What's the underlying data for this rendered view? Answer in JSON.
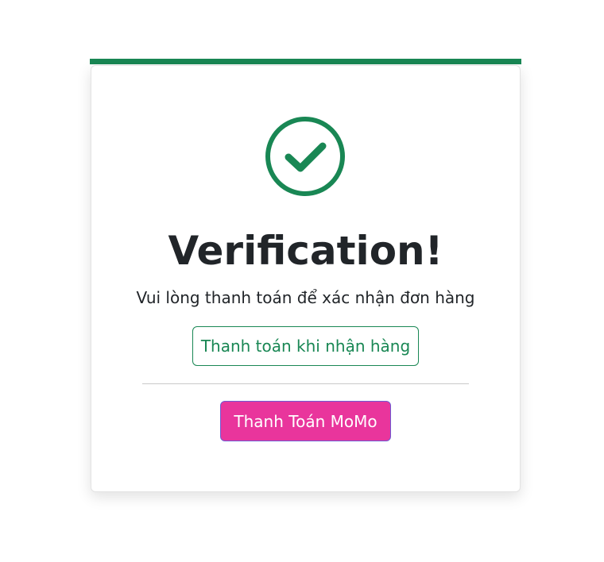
{
  "card": {
    "title": "Verification!",
    "message": "Vui lòng thanh toán để xác nhận đơn hàng"
  },
  "icons": {
    "status": "check-circle-icon"
  },
  "actions": {
    "cod_label": "Thanh toán khi nhận hàng",
    "momo_label": "Thanh Toán MoMo"
  },
  "colors": {
    "success": "#198754",
    "momo": "#e9359c",
    "text": "#212529"
  }
}
